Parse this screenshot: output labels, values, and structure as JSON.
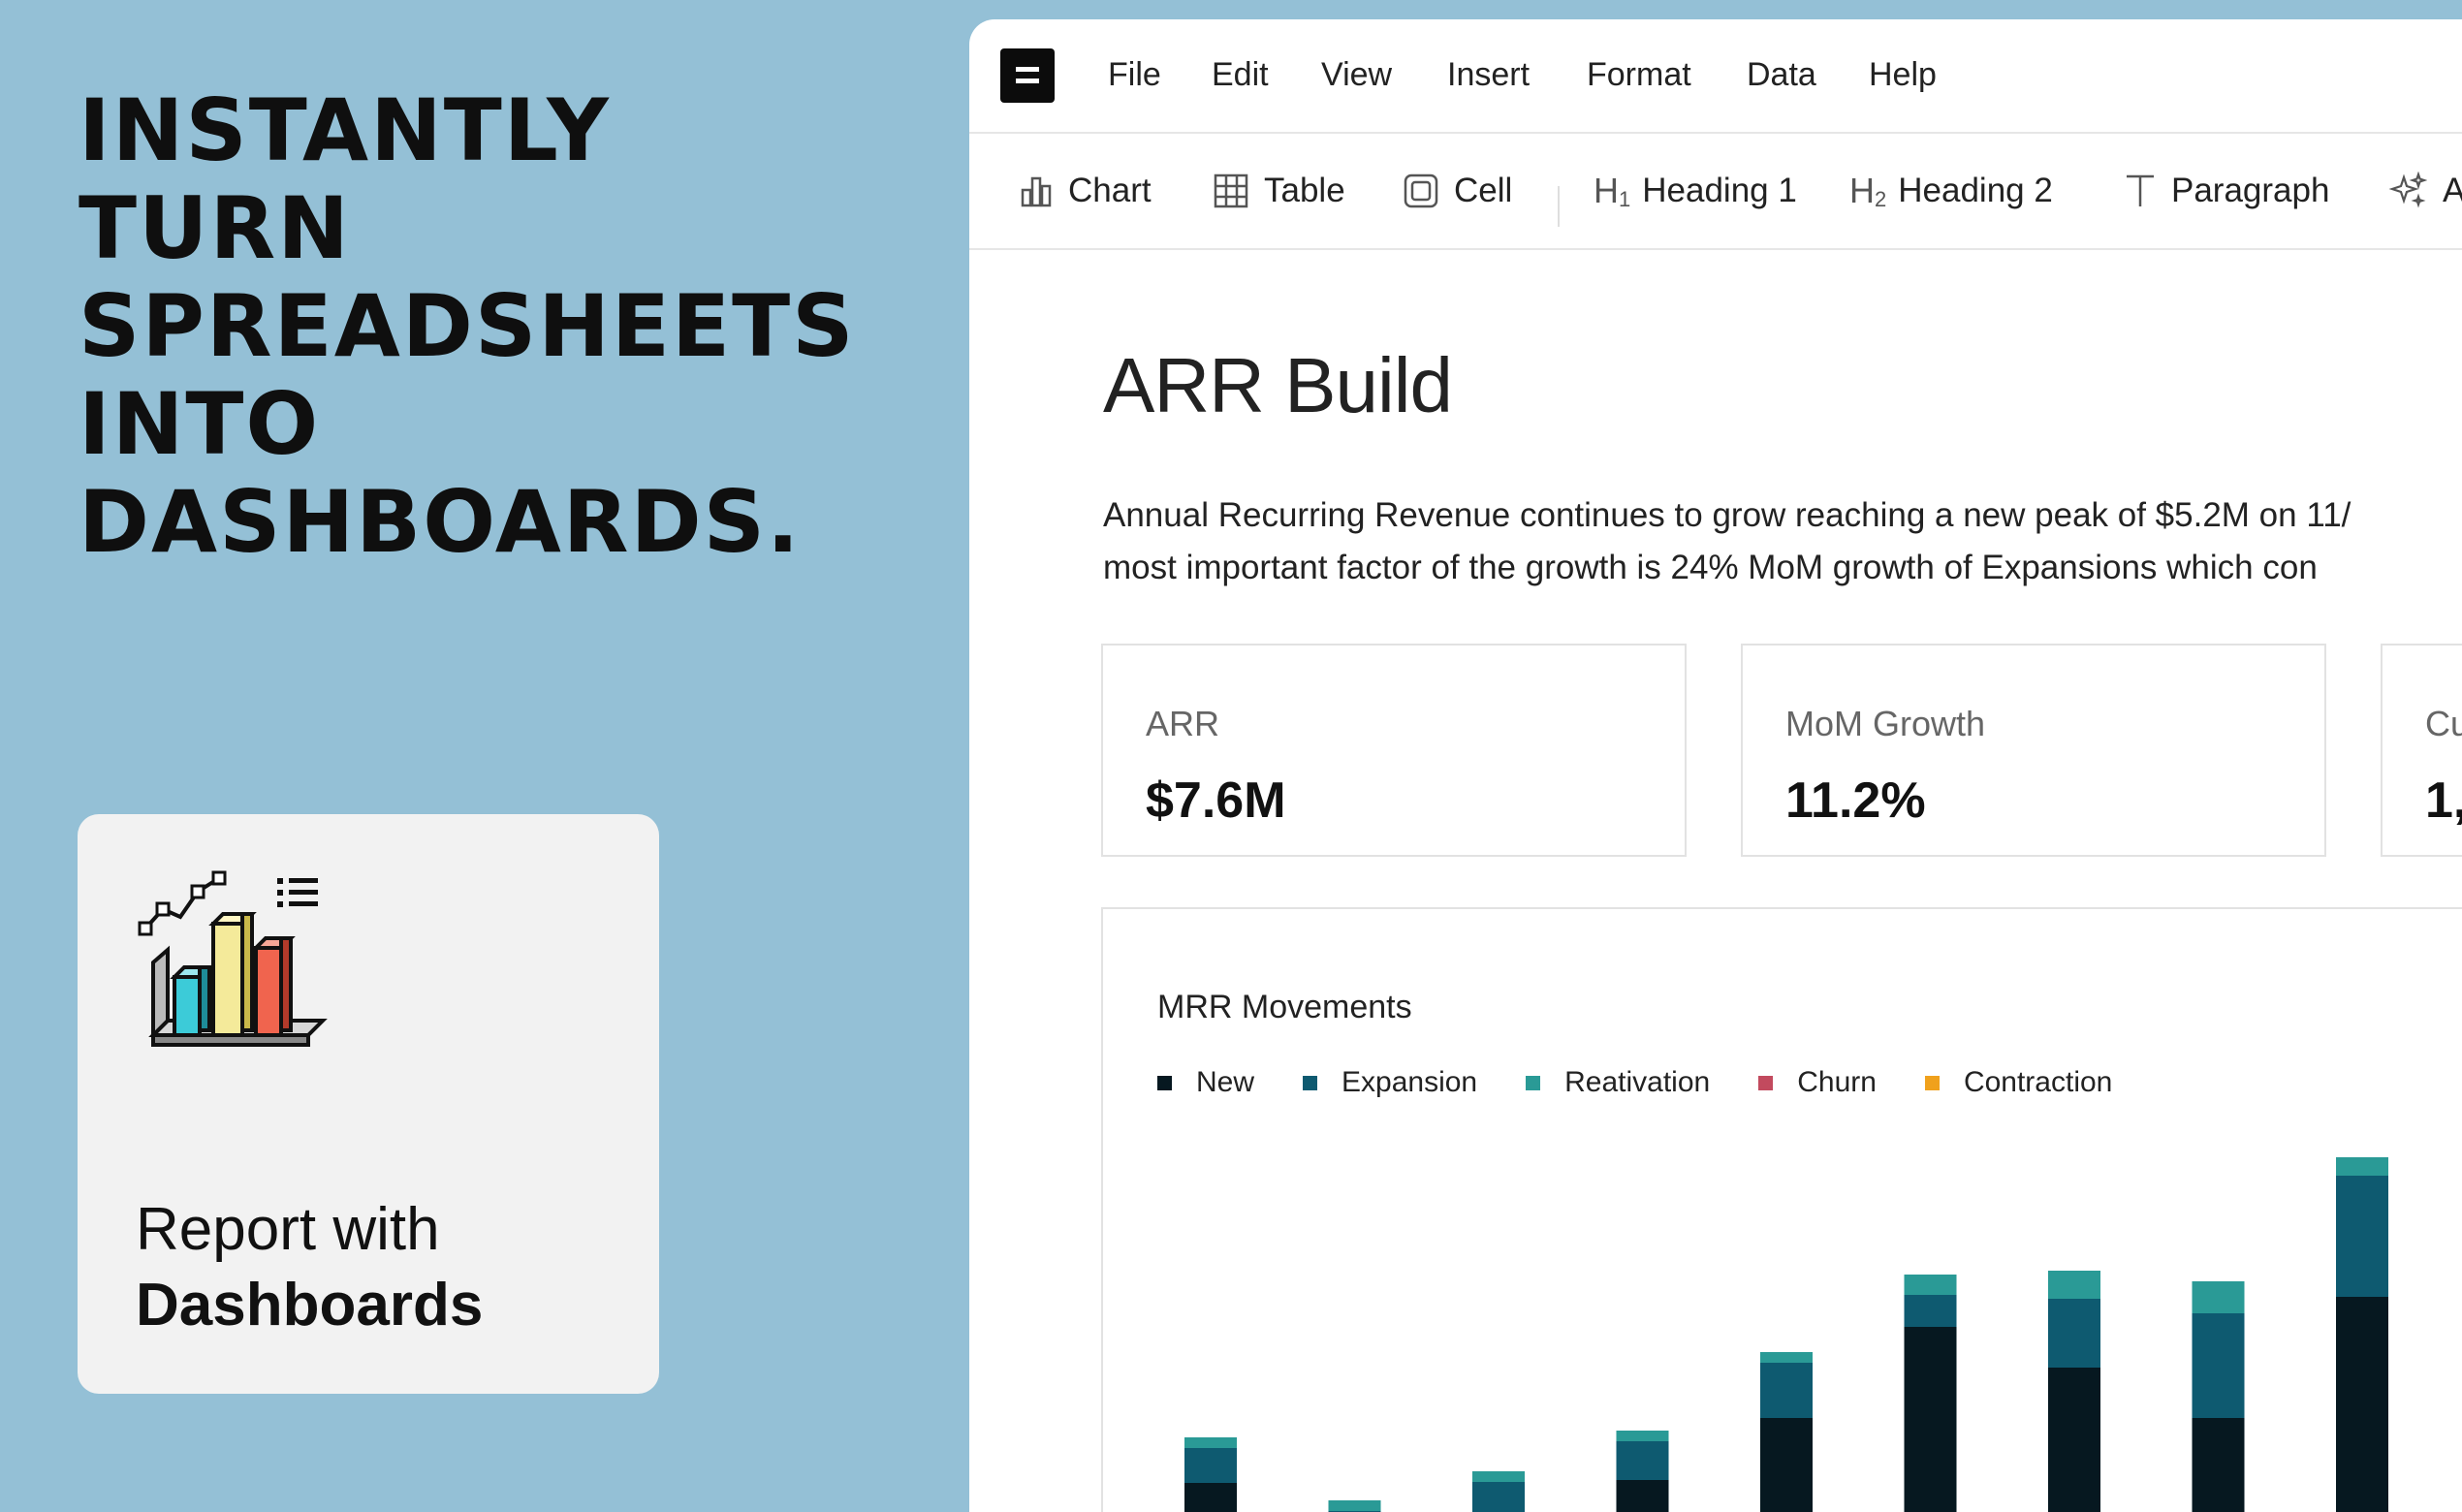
{
  "promo": {
    "headline": "INSTANTLY\nTURN\nSPREADSHEETS\nINTO\nDASHBOARDS.",
    "card": {
      "line1": "Report with",
      "line2": "Dashboards"
    }
  },
  "app": {
    "menu": [
      "File",
      "Edit",
      "View",
      "Insert",
      "Format",
      "Data",
      "Help"
    ],
    "toolbar": {
      "chart": "Chart",
      "table": "Table",
      "cell": "Cell",
      "heading1": "Heading 1",
      "heading2": "Heading 2",
      "paragraph": "Paragraph",
      "ai": "A"
    },
    "document": {
      "title": "ARR Build",
      "paragraph_line1": "Annual Recurring Revenue continues to grow reaching a new peak of $5.2M on 11/",
      "paragraph_line2": "most important factor of the growth is 24% MoM growth of Expansions which con"
    },
    "kpis": [
      {
        "label": "ARR",
        "value": "$7.6M"
      },
      {
        "label": "MoM Growth",
        "value": "11.2%"
      },
      {
        "label": "Cu",
        "value": "1,("
      }
    ]
  },
  "colors": {
    "background": "#94c0d6",
    "new": "#061820",
    "expansion": "#0e5a70",
    "reactivation": "#2a9a96",
    "churn": "#c24a5e",
    "contraction": "#f0a11c"
  },
  "chart_data": {
    "type": "bar",
    "stacked": true,
    "title": "MRR Movements",
    "legend_position": "top-left",
    "categories": [
      "",
      "",
      "",
      "",
      "",
      "",
      "",
      "",
      ""
    ],
    "ylim": [
      0,
      400
    ],
    "series": [
      {
        "name": "New",
        "color": "#061820",
        "values": [
          58,
          0,
          12,
          61,
          125,
          219,
          177,
          125,
          250
        ]
      },
      {
        "name": "Expansion",
        "color": "#0e5a70",
        "values": [
          36,
          29,
          47,
          40,
          57,
          33,
          71,
          108,
          125
        ]
      },
      {
        "name": "Reativation",
        "color": "#2a9a96",
        "values": [
          11,
          11,
          11,
          11,
          11,
          21,
          29,
          33,
          19
        ]
      },
      {
        "name": "Churn",
        "color": "#c24a5e",
        "values": [
          0,
          0,
          0,
          0,
          0,
          0,
          0,
          0,
          0
        ]
      },
      {
        "name": "Contraction",
        "color": "#f0a11c",
        "values": [
          0,
          0,
          0,
          0,
          0,
          0,
          0,
          0,
          0
        ]
      }
    ]
  }
}
